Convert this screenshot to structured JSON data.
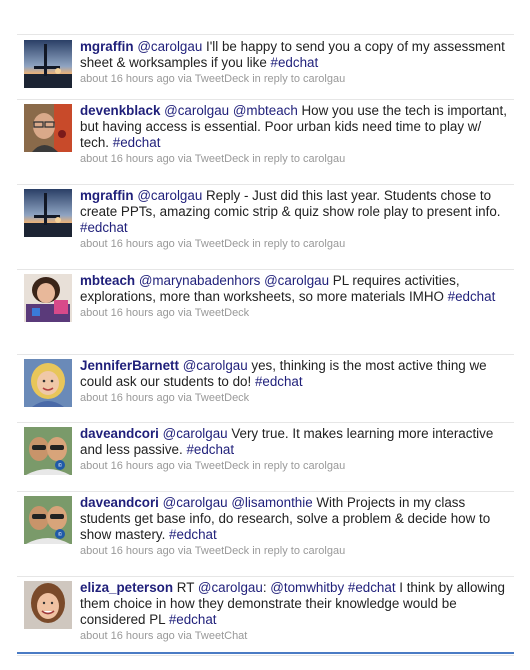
{
  "tweets": [
    {
      "author": "mgraffin",
      "avatar": "sunset-pier-avatar",
      "parts": [
        {
          "t": "mention",
          "v": "@carolgau"
        },
        {
          "t": "text",
          "v": " I'll be happy to send you a copy of my assessment sheet & worksamples if you like "
        },
        {
          "t": "hashtag",
          "v": "#edchat"
        }
      ],
      "meta": "about 16 hours ago via TweetDeck in reply to carolgau"
    },
    {
      "author": "devenkblack",
      "avatar": "man-glasses-avatar",
      "parts": [
        {
          "t": "mention",
          "v": "@carolgau"
        },
        {
          "t": "text",
          "v": " "
        },
        {
          "t": "mention",
          "v": "@mbteach"
        },
        {
          "t": "text",
          "v": " How you use the tech is important, but having access is essential. Poor urban kids need time to play w/ tech. "
        },
        {
          "t": "hashtag",
          "v": "#edchat"
        }
      ],
      "meta": "about 16 hours ago via TweetDeck in reply to carolgau"
    },
    {
      "author": "mgraffin",
      "avatar": "sunset-pier-avatar",
      "parts": [
        {
          "t": "mention",
          "v": "@carolgau"
        },
        {
          "t": "text",
          "v": " Reply - Just did this last year. Students chose to create PPTs, amazing comic strip & quiz show role play to present info. "
        },
        {
          "t": "hashtag",
          "v": "#edchat"
        }
      ],
      "meta": "about 16 hours ago via TweetDeck in reply to carolgau"
    },
    {
      "author": "mbteach",
      "avatar": "woman-dark-hair-avatar",
      "parts": [
        {
          "t": "mention",
          "v": "@marynabadenhors"
        },
        {
          "t": "text",
          "v": " "
        },
        {
          "t": "mention",
          "v": "@carolgau"
        },
        {
          "t": "text",
          "v": " PL requires activities, explorations, more than worksheets, so more materials IMHO "
        },
        {
          "t": "hashtag",
          "v": "#edchat"
        }
      ],
      "meta": "about 16 hours ago via TweetDeck"
    },
    {
      "author": "JenniferBarnett",
      "avatar": "blonde-woman-avatar",
      "parts": [
        {
          "t": "mention",
          "v": "@carolgau"
        },
        {
          "t": "text",
          "v": " yes, thinking is the most active thing we could ask our students to do! "
        },
        {
          "t": "hashtag",
          "v": "#edchat"
        }
      ],
      "meta": "about 16 hours ago via TweetDeck"
    },
    {
      "author": "daveandcori",
      "avatar": "couple-sunglasses-avatar",
      "parts": [
        {
          "t": "mention",
          "v": "@carolgau"
        },
        {
          "t": "text",
          "v": " Very true. It makes learning more interactive and less passive. "
        },
        {
          "t": "hashtag",
          "v": "#edchat"
        }
      ],
      "meta": "about 16 hours ago via TweetDeck in reply to carolgau"
    },
    {
      "author": "daveandcori",
      "avatar": "couple-sunglasses-avatar",
      "parts": [
        {
          "t": "mention",
          "v": "@carolgau"
        },
        {
          "t": "text",
          "v": " "
        },
        {
          "t": "mention",
          "v": "@lisamonthie"
        },
        {
          "t": "text",
          "v": " With Projects in my class students get base info, do research, solve a problem & decide how to show mastery. "
        },
        {
          "t": "hashtag",
          "v": "#edchat"
        }
      ],
      "meta": "about 16 hours ago via TweetDeck in reply to carolgau"
    },
    {
      "author": "eliza_peterson",
      "avatar": "smiling-woman-avatar",
      "parts": [
        {
          "t": "text",
          "v": "RT "
        },
        {
          "t": "mention",
          "v": "@carolgau"
        },
        {
          "t": "text",
          "v": ": "
        },
        {
          "t": "mention",
          "v": "@tomwhitby"
        },
        {
          "t": "text",
          "v": " "
        },
        {
          "t": "hashtag",
          "v": "#edchat"
        },
        {
          "t": "text",
          "v": " I think by allowing them choice in how they demonstrate their knowledge would be considered PL "
        },
        {
          "t": "hashtag",
          "v": "#edchat"
        }
      ],
      "meta": "about 16 hours ago via TweetChat"
    }
  ]
}
